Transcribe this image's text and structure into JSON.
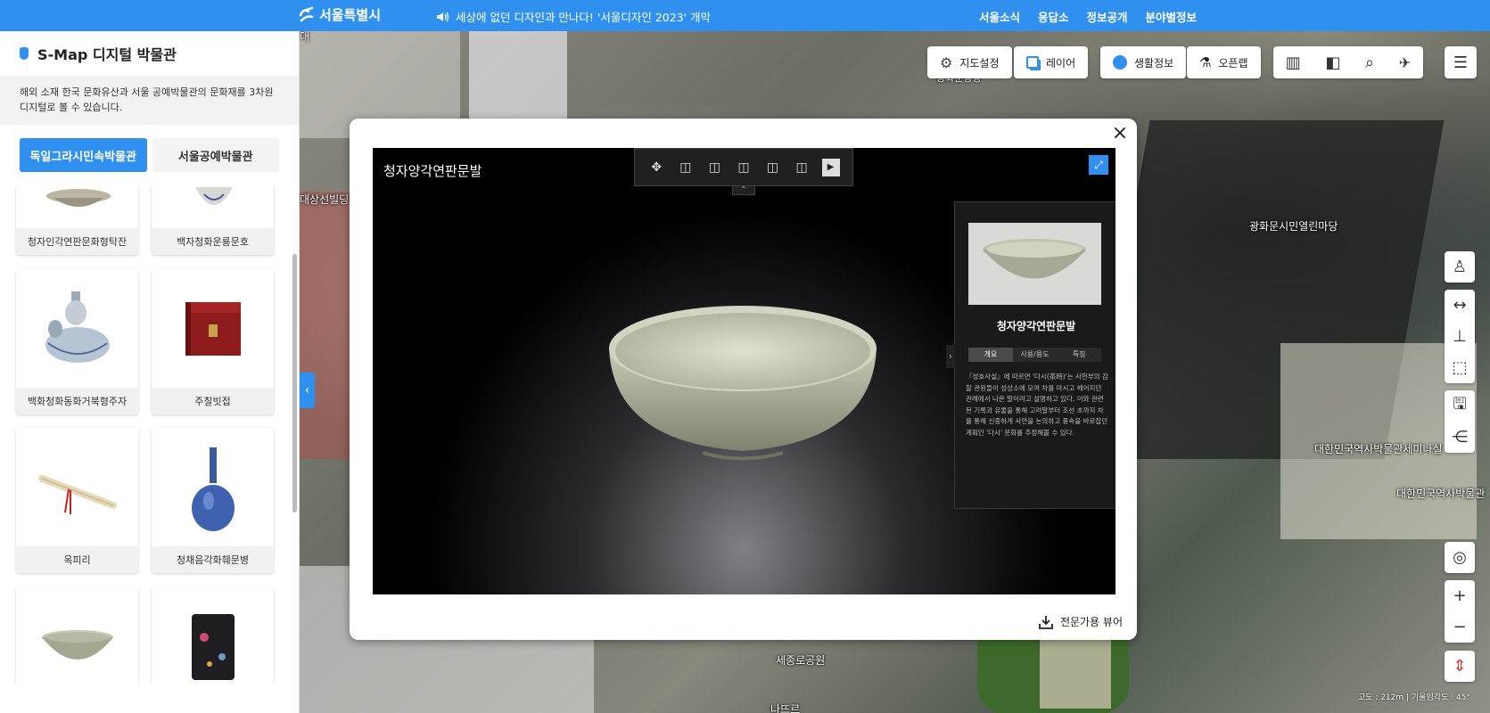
{
  "topbar": {
    "logo_text": "서울특별시",
    "notice": "세상에 없던 디자인과 만나다! '서울디자인 2023' 개막",
    "nav": [
      "서울소식",
      "응답소",
      "정보공개",
      "분야별정보"
    ]
  },
  "panel": {
    "title": "S-Map 디지털 박물관",
    "description": "해외 소재 한국 문화유산과 서울 공예박물관의 문화재를 3차원 디지털로 볼 수 있습니다.",
    "tabs": [
      "독일그라시민속박물관",
      "서울공예박물관"
    ],
    "items": [
      {
        "label": "청자인각연판문화형탁잔",
        "icon": "celadon-cup-stand-image"
      },
      {
        "label": "백자청화운룡문호",
        "icon": "white-porcelain-jar-image"
      },
      {
        "label": "백화청화동화거북형주자",
        "icon": "turtle-ewer-image"
      },
      {
        "label": "주칠빗접",
        "icon": "red-lacquer-box-image"
      },
      {
        "label": "옥피리",
        "icon": "jade-flute-image"
      },
      {
        "label": "청채음각화훼문병",
        "icon": "blue-vase-image"
      },
      {
        "label": "",
        "icon": "celadon-bowl-image"
      },
      {
        "label": "",
        "icon": "black-lacquer-case-image"
      }
    ]
  },
  "map_tools": {
    "settings": "지도설정",
    "layer": "레이어",
    "life_info": "생활정보",
    "open_app": "오픈랩"
  },
  "map_labels": {
    "plaza": "광화문시민열린마당",
    "museum_hall": "대한민국역사박물관세미나실",
    "museum": "대한민국역사박물관",
    "park": "세종로공원",
    "bottom": "나뜨르",
    "left_top": "대상선빌딩",
    "left_mid": "대",
    "top_label": "광화문광장"
  },
  "map_status": "고도 : 212m | 기울임각도 : 45°",
  "modal": {
    "viewer_title": "청자양각연판문발",
    "info_name": "청자양각연판문발",
    "info_tabs": [
      "개요",
      "사용/용도",
      "특징"
    ],
    "info_text": "『성호사설』에 따르면 '다시(茶時)'는 사헌부의 감찰 관원들이 성상소에 모여 차를 마시고 헤어지던 관례에서 나온 말이라고 설명하고 있다. 이와 관련된 기록과 유물을 통해 고려말부터 조선 초까지 차를 통해 신중하게 사안을 논의하고 풍속을 바로잡던 계획인 '다시' 문화를 추정해볼 수 있다.",
    "download_label": "전문가용 뷰어"
  },
  "colors": {
    "brand_blue": "#2f90f0"
  }
}
